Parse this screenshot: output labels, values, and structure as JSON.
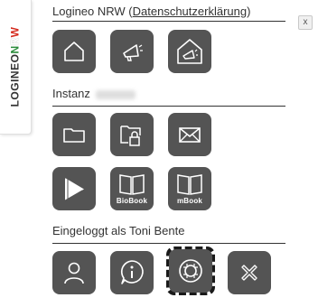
{
  "brand": {
    "logo_text_part1": "LOGINEO",
    "logo_n": "N",
    "logo_r": "R",
    "logo_w": "W"
  },
  "close_label": "x",
  "header": {
    "title_prefix": "Logineo NRW (",
    "privacy_link": "Datenschutzerklärung",
    "title_suffix": ")"
  },
  "instance": {
    "label": "Instanz"
  },
  "user": {
    "label": "Eingeloggt als Toni Bente"
  },
  "tiles": {
    "biobook_label": "BioBook",
    "mbook_label": "mBook"
  },
  "colors": {
    "tile_bg": "#545454",
    "logo_green": "#2a8b3a",
    "logo_red": "#d52b1e"
  },
  "icons": {
    "row1": [
      "home-icon",
      "megaphone-icon",
      "house-megaphone-icon"
    ],
    "row2": [
      "folder-icon",
      "locked-folder-icon",
      "mail-icon"
    ],
    "row3": [
      "play-book-icon",
      "biobook-icon",
      "mbook-icon"
    ],
    "row4": [
      "user-icon",
      "info-icon",
      "lifebuoy-icon",
      "close-x-icon"
    ]
  }
}
